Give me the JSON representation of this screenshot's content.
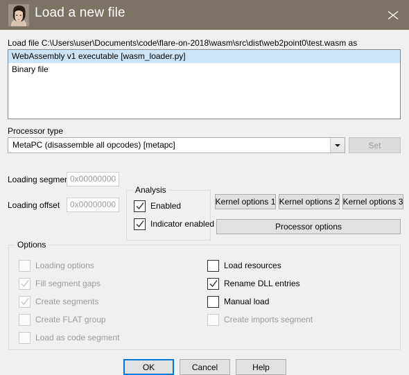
{
  "window": {
    "title": "Load a new file",
    "icon": "ida-woman-icon",
    "close_icon": "close-icon",
    "titlebar_color": "#7d7364"
  },
  "loadfile": {
    "label": "Load file C:\\Users\\user\\Documents\\code\\flare-on-2018\\wasm\\src\\dist\\web2point0\\test.wasm as",
    "loaders": [
      {
        "label": "WebAssembly v1 executable [wasm_loader.py]",
        "selected": true
      },
      {
        "label": "Binary file",
        "selected": false
      }
    ],
    "selection_color": "#cce4f7"
  },
  "processor": {
    "label": "Processor type",
    "selected": "MetaPC (disassemble all opcodes) [metapc]",
    "dropdown_icon": "chevron-down-icon",
    "set_label": "Set",
    "set_disabled": true
  },
  "loading": {
    "segment_label": "Loading segment",
    "segment_value": "0x00000000",
    "offset_label": "Loading offset",
    "offset_value": "0x00000000"
  },
  "analysis": {
    "title": "Analysis",
    "items": [
      {
        "label": "Enabled",
        "checked": true,
        "disabled": false
      },
      {
        "label": "Indicator enabled",
        "checked": true,
        "disabled": false
      }
    ]
  },
  "kernel": {
    "opt1": "Kernel options 1",
    "opt2": "Kernel options 2",
    "opt3": "Kernel options 3",
    "processor_options": "Processor options"
  },
  "options": {
    "title": "Options",
    "left": [
      {
        "label": "Loading options",
        "checked": false,
        "disabled": true
      },
      {
        "label": "Fill segment gaps",
        "checked": true,
        "disabled": true
      },
      {
        "label": "Create segments",
        "checked": true,
        "disabled": true
      },
      {
        "label": "Create FLAT group",
        "checked": false,
        "disabled": true
      },
      {
        "label": "Load as code segment",
        "checked": false,
        "disabled": true
      }
    ],
    "right": [
      {
        "label": "Load resources",
        "checked": false,
        "disabled": false
      },
      {
        "label": "Rename DLL entries",
        "checked": true,
        "disabled": false
      },
      {
        "label": "Manual load",
        "checked": false,
        "disabled": false
      },
      {
        "label": "Create imports segment",
        "checked": false,
        "disabled": true
      }
    ]
  },
  "buttons": {
    "ok": "OK",
    "cancel": "Cancel",
    "help": "Help",
    "default_color": "#0078d7"
  }
}
